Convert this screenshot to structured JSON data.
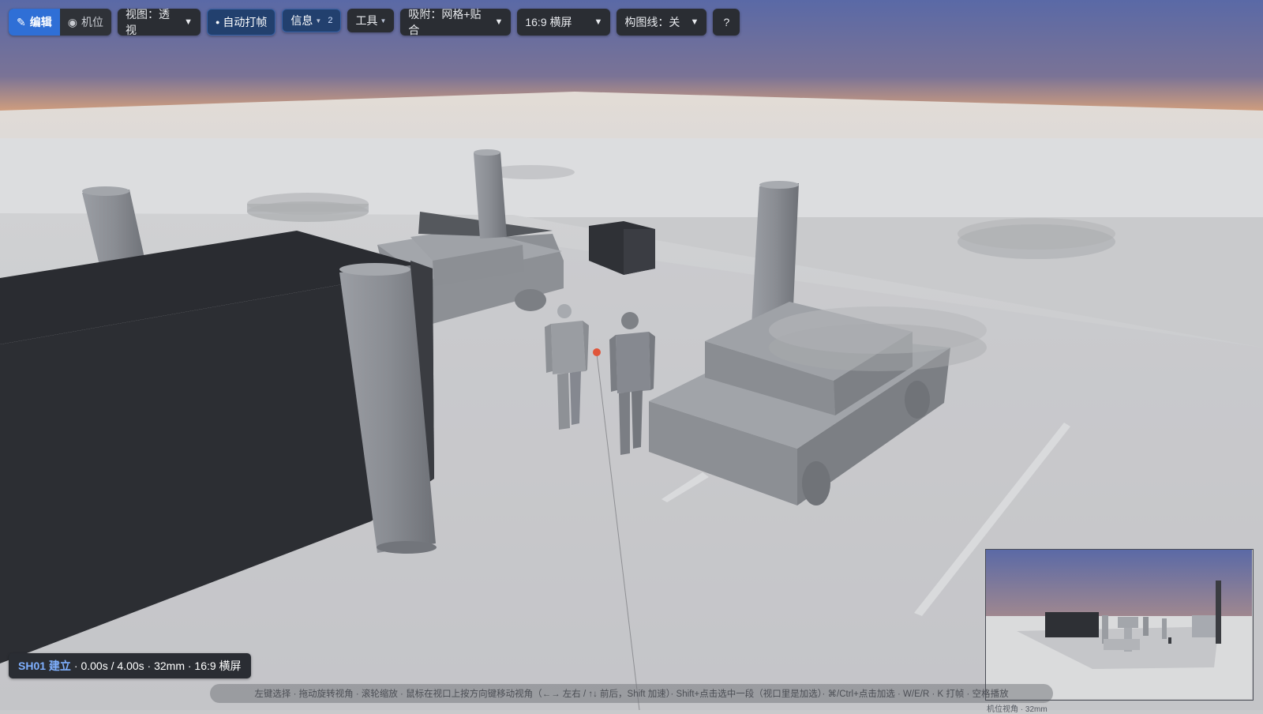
{
  "toolbar": {
    "mode_edit": "编辑",
    "mode_camera": "机位",
    "view_select": "视图：透视",
    "auto_keyframe": "自动打帧",
    "info": "信息",
    "info_count": "2",
    "tools": "工具",
    "snap_select": "吸附：网格+贴合",
    "aspect_select": "16:9 横屏",
    "guides_select": "构图线：关",
    "help": "?"
  },
  "status": {
    "shot_id": "SH01 建立",
    "shot_detail": "· 0.00s / 4.00s · 32mm · 16:9 横屏"
  },
  "hint": "左键选择 · 拖动旋转视角 · 滚轮缩放 · 鼠标在视口上按方向键移动视角（←→ 左右 / ↑↓ 前后，Shift 加速）· Shift+点击选中一段（视口里是加选）· ⌘/Ctrl+点击加选 · W/E/R · K 打帧 · 空格播放",
  "minimap": {
    "label": "机位视角 · 32mm"
  },
  "colors": {
    "accent": "#2f6fd6",
    "toolbar_bg": "#2a2d33",
    "sky_top": "#5b6ca8",
    "horizon": "#d8a27c"
  }
}
